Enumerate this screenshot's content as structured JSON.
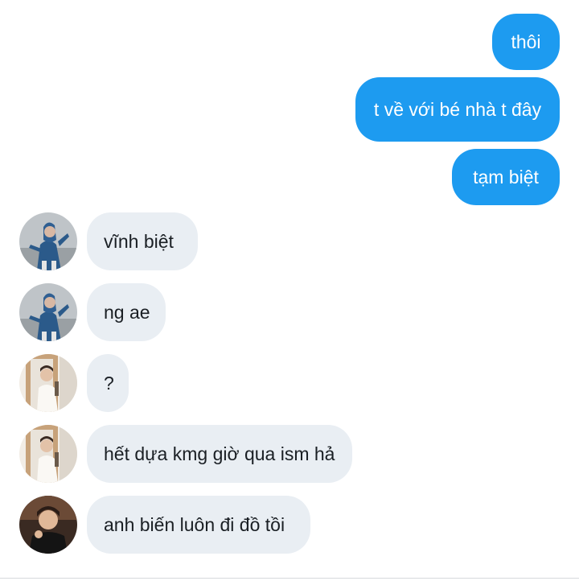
{
  "messages": [
    {
      "side": "sent",
      "text": "thôi"
    },
    {
      "side": "sent",
      "text": "t về với bé nhà t đây"
    },
    {
      "side": "sent",
      "text": "tạm biệt"
    },
    {
      "side": "received",
      "avatar": "user-a-avatar",
      "text": "vĩnh biệt"
    },
    {
      "side": "received",
      "avatar": "user-a-avatar",
      "text": "ng ae"
    },
    {
      "side": "received",
      "avatar": "user-b-avatar",
      "text": "?"
    },
    {
      "side": "received",
      "avatar": "user-b-avatar",
      "text": "hết dựa kmg giờ qua ism hả"
    },
    {
      "side": "received",
      "avatar": "user-c-avatar",
      "text": "anh biến luôn đi đồ tồi"
    }
  ],
  "colors": {
    "sent_bubble": "#1d9bf0",
    "received_bubble": "#e9eef3",
    "sent_text": "#ffffff",
    "received_text": "#1a1f24"
  }
}
